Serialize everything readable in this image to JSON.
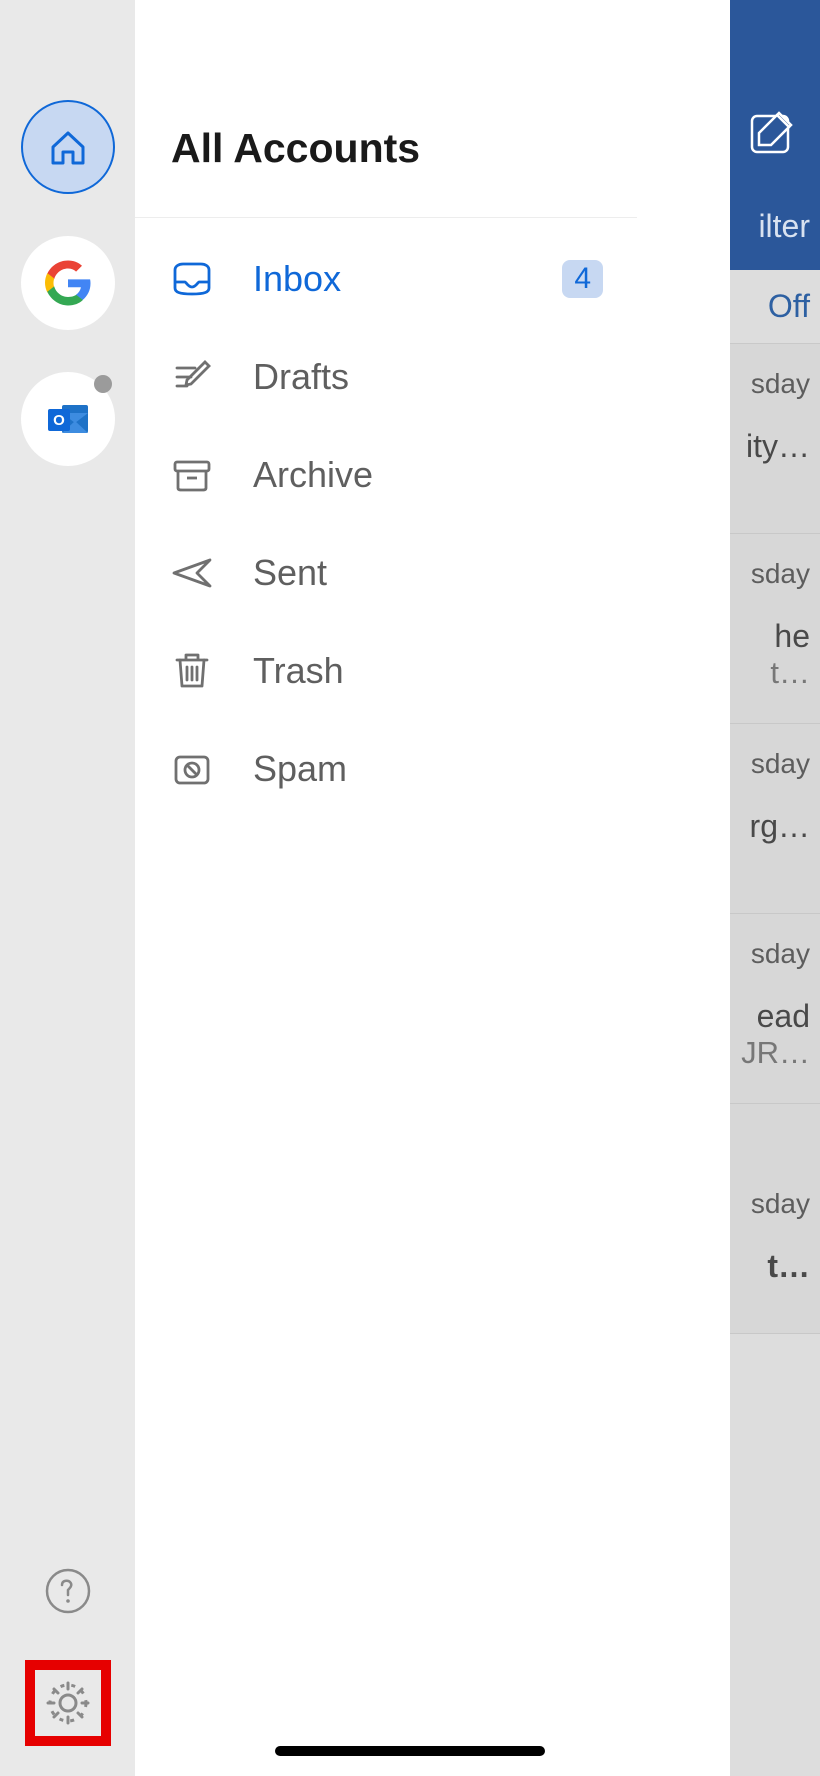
{
  "drawer": {
    "title": "All Accounts",
    "folders": [
      {
        "icon": "inbox",
        "label": "Inbox",
        "badge": "4",
        "active": true
      },
      {
        "icon": "drafts",
        "label": "Drafts"
      },
      {
        "icon": "archive",
        "label": "Archive"
      },
      {
        "icon": "sent",
        "label": "Sent"
      },
      {
        "icon": "trash",
        "label": "Trash"
      },
      {
        "icon": "spam",
        "label": "Spam"
      }
    ],
    "accounts": [
      {
        "type": "home",
        "active": true,
        "name": "home"
      },
      {
        "type": "google",
        "name": "google-account"
      },
      {
        "type": "outlook",
        "name": "outlook-account",
        "status": "inactive"
      }
    ],
    "bottom": {
      "help": "?",
      "settings": "gear"
    }
  },
  "background": {
    "compose_icon": "compose",
    "filter_label": "ilter",
    "off_toggle": "Off",
    "rows": [
      {
        "time": "sday",
        "line1": "ity…"
      },
      {
        "time": "sday",
        "line1": "he",
        "line2": " t…"
      },
      {
        "time": "sday",
        "line1": "rg…"
      },
      {
        "time": "sday",
        "line1": "ead",
        "line2": "JR…"
      },
      {
        "time": "sday",
        "line1": " t…"
      }
    ]
  },
  "colors": {
    "accent": "#0f68d8",
    "rail_bg": "#e9e9e9",
    "header_blue": "#2b579a",
    "highlight_red": "#e60000"
  }
}
